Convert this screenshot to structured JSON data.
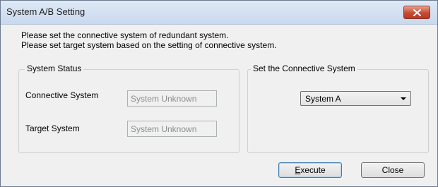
{
  "window": {
    "title": "System A/B Setting"
  },
  "messages": {
    "line1": "Please set the connective system of redundant system.",
    "line2": "Please set target system based on the setting of connective system."
  },
  "system_status": {
    "legend": "System Status",
    "connective_label": "Connective System",
    "connective_value": "System Unknown",
    "target_label": "Target System",
    "target_value": "System Unknown"
  },
  "connective_system": {
    "legend": "Set the Connective System",
    "selected": "System A"
  },
  "buttons": {
    "execute_mnemonic": "E",
    "execute_rest": "xecute",
    "close": "Close"
  },
  "colors": {
    "close_button": "#c74a33",
    "titlebar": "#c9d9ee",
    "disabled_text": "#8d8d8d"
  },
  "icons": {
    "close": "close-x-icon",
    "dropdown": "chevron-down-icon"
  }
}
